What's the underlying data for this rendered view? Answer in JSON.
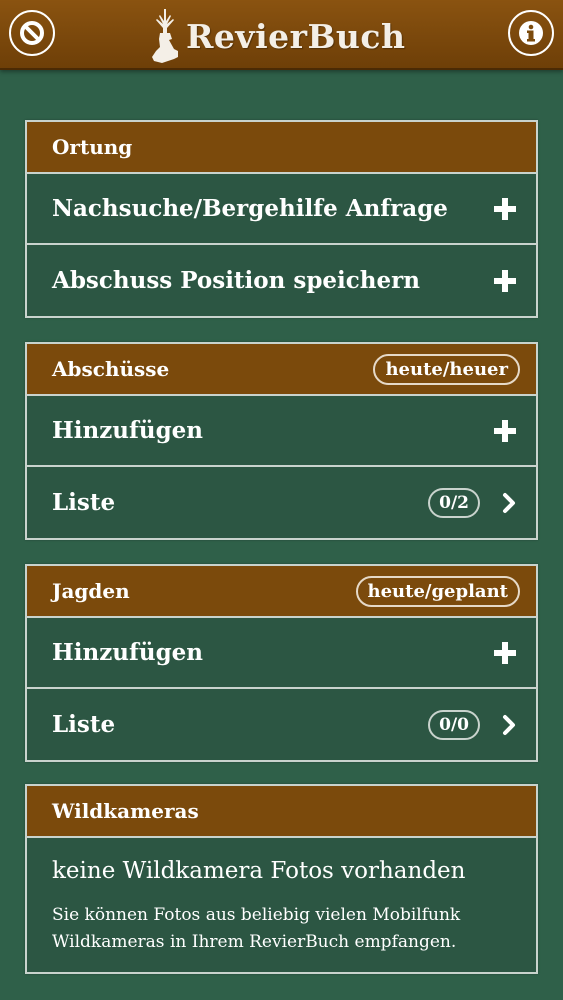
{
  "header": {
    "app_name": "RevierBuch",
    "left_icon": "block-icon",
    "right_icon": "info-icon",
    "colors": {
      "header": "#7b4a0c",
      "background": "#2f6049"
    }
  },
  "ortung": {
    "title": "Ortung",
    "rows": [
      {
        "label": "Nachsuche/Bergehilfe Anfrage",
        "icon": "plus-icon"
      },
      {
        "label": "Abschuss Position speichern",
        "icon": "plus-icon"
      }
    ]
  },
  "abschuesse": {
    "title": "Abschüsse",
    "badge": "heute/heuer",
    "add_label": "Hinzufügen",
    "list_label": "Liste",
    "list_count": "0/2"
  },
  "jagden": {
    "title": "Jagden",
    "badge": "heute/geplant",
    "add_label": "Hinzufügen",
    "list_label": "Liste",
    "list_count": "0/0"
  },
  "wildkameras": {
    "title": "Wildkameras",
    "empty_title": "keine Wildkamera Fotos vorhanden",
    "empty_text": "Sie können Fotos aus beliebig vielen Mobilfunk Wildkameras in Ihrem RevierBuch empfangen."
  }
}
